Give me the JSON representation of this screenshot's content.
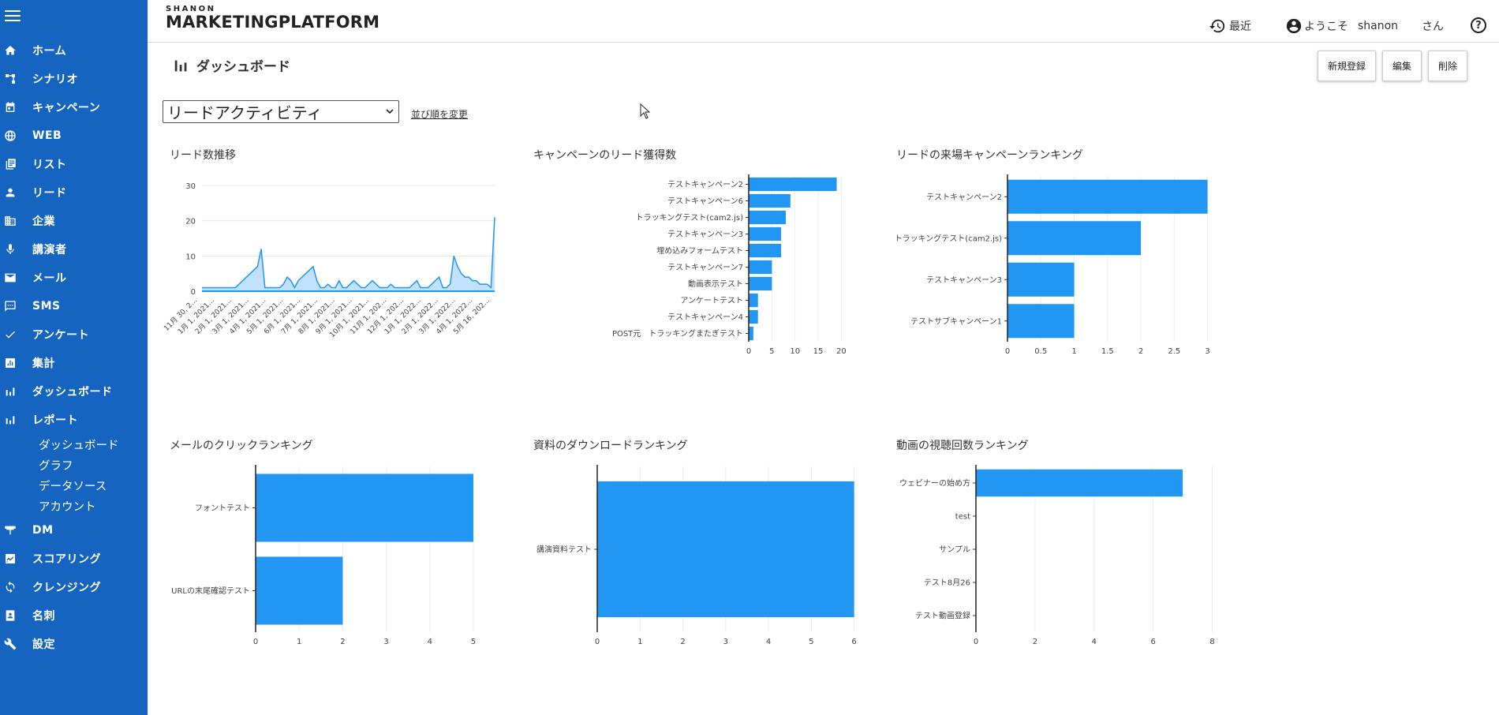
{
  "app": {
    "brand_top": "SHANON",
    "brand_main": "MARKETINGPLATFORM"
  },
  "sidebar": {
    "items": [
      {
        "label": "ホーム",
        "icon": "home-icon"
      },
      {
        "label": "シナリオ",
        "icon": "scenario-icon"
      },
      {
        "label": "キャンペーン",
        "icon": "calendar-icon"
      },
      {
        "label": "WEB",
        "icon": "globe-icon"
      },
      {
        "label": "リスト",
        "icon": "list-icon"
      },
      {
        "label": "リード",
        "icon": "person-icon"
      },
      {
        "label": "企業",
        "icon": "building-icon"
      },
      {
        "label": "講演者",
        "icon": "microphone-icon"
      },
      {
        "label": "メール",
        "icon": "mail-icon"
      },
      {
        "label": "SMS",
        "icon": "sms-icon"
      },
      {
        "label": "アンケート",
        "icon": "check-icon"
      },
      {
        "label": "集計",
        "icon": "report-icon"
      },
      {
        "label": "ダッシュボード",
        "icon": "bar-chart-icon"
      },
      {
        "label": "レポート",
        "icon": "bar-chart-icon"
      }
    ],
    "subitems": [
      {
        "label": "ダッシュボード"
      },
      {
        "label": "グラフ"
      },
      {
        "label": "データソース"
      },
      {
        "label": "アカウント"
      }
    ],
    "items2": [
      {
        "label": "DM",
        "icon": "dm-icon"
      },
      {
        "label": "スコアリング",
        "icon": "scoring-icon"
      },
      {
        "label": "クレンジング",
        "icon": "cleansing-icon"
      },
      {
        "label": "名刺",
        "icon": "business-card-icon"
      },
      {
        "label": "設定",
        "icon": "wrench-icon"
      }
    ]
  },
  "header": {
    "recent": "最近",
    "welcome": "ようこそ",
    "user": "shanon",
    "san": "さん",
    "help": "?"
  },
  "page": {
    "title": "ダッシュボード",
    "actions": {
      "new": "新規登録",
      "edit": "編集",
      "delete": "削除"
    },
    "select_value": "リードアクティビティ",
    "reorder": "並び順を変更"
  },
  "colors": {
    "sidebar": "#1565c0",
    "bar": "#2196f3"
  },
  "chart_data": [
    {
      "type": "area",
      "title": "リード数推移",
      "ylim": [
        0,
        30
      ],
      "yticks": [
        0,
        10,
        20,
        30
      ],
      "xticks": [
        "11月 30, 2...",
        "1月 1, 2021...",
        "2月 1, 2021...",
        "3月 1, 2021...",
        "4月 1, 2021...",
        "5月 1, 2021...",
        "6月 1, 2021...",
        "7月 1, 2021...",
        "8月 1, 2021...",
        "9月 1, 2021...",
        "10月 1, 2021...",
        "11月 1, 202...",
        "12月 1, 202...",
        "1月 1, 2022...",
        "2月 1, 2022...",
        "3月 1, 2022...",
        "4月 1, 2022...",
        "5月 16, 202..."
      ],
      "values": [
        1,
        1,
        1,
        1,
        1,
        1,
        1,
        1,
        1,
        1,
        2,
        3,
        4,
        5,
        6,
        7,
        12,
        1,
        1,
        1,
        1,
        1,
        2,
        4,
        3,
        1,
        3,
        4,
        5,
        6,
        7,
        3,
        1,
        1,
        2,
        1,
        1,
        3,
        1,
        1,
        2,
        3,
        2,
        1,
        1,
        2,
        3,
        2,
        1,
        1,
        1,
        2,
        1,
        1,
        1,
        1,
        1,
        2,
        3,
        1,
        1,
        1,
        2,
        3,
        4,
        1,
        1,
        2,
        10,
        7,
        5,
        4,
        4,
        3,
        3,
        2,
        2,
        2,
        1,
        21
      ]
    },
    {
      "type": "bar",
      "orientation": "horizontal",
      "title": "キャンペーンのリード獲得数",
      "categories": [
        "テストキャンペーン2",
        "テストキャンペーン6",
        "トラッキングテスト(cam2.js)",
        "テストキャンペーン3",
        "埋め込みフォームテスト",
        "テストキャンペーン7",
        "動画表示テスト",
        "アンケートテスト",
        "テストキャンペーン4",
        "POST元　トラッキングまたぎテスト"
      ],
      "values": [
        19,
        9,
        8,
        7,
        7,
        5,
        5,
        2,
        2,
        1
      ],
      "xlim": [
        0,
        23
      ],
      "xticks": [
        0,
        5,
        10,
        15,
        20
      ]
    },
    {
      "type": "bar",
      "orientation": "horizontal",
      "title": "リードの来場キャンペーンランキング",
      "categories": [
        "テストキャンペーン2",
        "トラッキングテスト(cam2.js)",
        "テストキャンペーン3",
        "テストサブキャンペーン1"
      ],
      "values": [
        3,
        2,
        1,
        1
      ],
      "xlim": [
        0,
        3.1
      ],
      "xticks": [
        0,
        0.5,
        1,
        1.5,
        2,
        2.5,
        3
      ]
    },
    {
      "type": "bar",
      "orientation": "horizontal",
      "title": "メールのクリックランキング",
      "categories": [
        "フォントテスト",
        "URLの末尾確認テスト"
      ],
      "values": [
        5,
        2
      ],
      "xlim": [
        0,
        5.2
      ],
      "xticks": [
        0,
        1,
        2,
        3,
        4,
        5
      ]
    },
    {
      "type": "bar",
      "orientation": "horizontal",
      "title": "資料のダウンロードランキング",
      "categories": [
        "講演資料テスト"
      ],
      "values": [
        6
      ],
      "xlim": [
        0,
        6.1
      ],
      "xticks": [
        0,
        1,
        2,
        3,
        4,
        5,
        6
      ]
    },
    {
      "type": "bar",
      "orientation": "horizontal",
      "title": "動画の視聴回数ランキング",
      "categories": [
        "ウェビナーの始め方",
        "test",
        "サンプル",
        "テスト8月26",
        "テスト動画登録"
      ],
      "values": [
        7,
        0,
        0,
        0,
        0
      ],
      "xlim": [
        0,
        8.2
      ],
      "xticks": [
        0,
        2,
        4,
        6,
        8
      ]
    }
  ]
}
